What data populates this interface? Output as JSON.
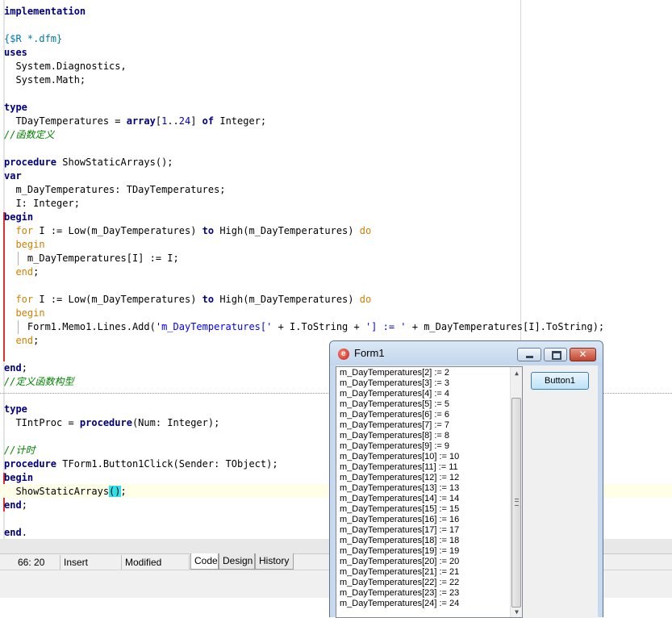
{
  "editor": {
    "lines": [
      {
        "tokens": [
          [
            "kw",
            "implementation"
          ]
        ]
      },
      {
        "tokens": []
      },
      {
        "tokens": [
          [
            "dir",
            "{$R *.dfm}"
          ]
        ]
      },
      {
        "tokens": [
          [
            "kw",
            "uses"
          ]
        ]
      },
      {
        "tokens": [
          [
            "p",
            "  System.Diagnostics,"
          ]
        ]
      },
      {
        "tokens": [
          [
            "p",
            "  System.Math;"
          ]
        ]
      },
      {
        "tokens": []
      },
      {
        "tokens": [
          [
            "kw",
            "type"
          ]
        ]
      },
      {
        "tokens": [
          [
            "p",
            "  TDayTemperatures = "
          ],
          [
            "kw",
            "array"
          ],
          [
            "p",
            "["
          ],
          [
            "num",
            "1"
          ],
          [
            "p",
            ".."
          ],
          [
            "num",
            "24"
          ],
          [
            "p",
            "] "
          ],
          [
            "kw",
            "of"
          ],
          [
            "p",
            " Integer;"
          ]
        ]
      },
      {
        "tokens": [
          [
            "cmt",
            "//函数定义"
          ]
        ]
      },
      {
        "tokens": []
      },
      {
        "tokens": [
          [
            "kw",
            "procedure"
          ],
          [
            "p",
            " ShowStaticArrays();"
          ]
        ]
      },
      {
        "tokens": [
          [
            "kw",
            "var"
          ]
        ]
      },
      {
        "tokens": [
          [
            "p",
            "  m_DayTemperatures: TDayTemperatures;"
          ]
        ]
      },
      {
        "tokens": [
          [
            "p",
            "  I: Integer;"
          ]
        ]
      },
      {
        "tokens": [
          [
            "kw",
            "begin"
          ]
        ]
      },
      {
        "tokens": [
          [
            "p",
            "  "
          ],
          [
            "kw2",
            "for"
          ],
          [
            "p",
            " I := Low(m_DayTemperatures) "
          ],
          [
            "kw",
            "to"
          ],
          [
            "p",
            " High(m_DayTemperatures) "
          ],
          [
            "kw2",
            "do"
          ]
        ]
      },
      {
        "tokens": [
          [
            "p",
            "  "
          ],
          [
            "kw2",
            "begin"
          ]
        ]
      },
      {
        "tokens": [
          [
            "p",
            "    m_DayTemperatures[I] := I;"
          ]
        ]
      },
      {
        "tokens": [
          [
            "p",
            "  "
          ],
          [
            "kw2",
            "end"
          ],
          [
            "p",
            ";"
          ]
        ]
      },
      {
        "tokens": []
      },
      {
        "tokens": [
          [
            "p",
            "  "
          ],
          [
            "kw2",
            "for"
          ],
          [
            "p",
            " I := Low(m_DayTemperatures) "
          ],
          [
            "kw",
            "to"
          ],
          [
            "p",
            " High(m_DayTemperatures) "
          ],
          [
            "kw2",
            "do"
          ]
        ]
      },
      {
        "tokens": [
          [
            "p",
            "  "
          ],
          [
            "kw2",
            "begin"
          ]
        ]
      },
      {
        "tokens": [
          [
            "p",
            "    Form1.Memo1.Lines.Add("
          ],
          [
            "str",
            "'m_DayTemperatures['"
          ],
          [
            "p",
            " + I.ToString + "
          ],
          [
            "str",
            "'] := '"
          ],
          [
            "p",
            " + m_DayTemperatures[I].ToString);"
          ]
        ]
      },
      {
        "tokens": [
          [
            "p",
            "  "
          ],
          [
            "kw2",
            "end"
          ],
          [
            "p",
            ";"
          ]
        ]
      },
      {
        "tokens": []
      },
      {
        "tokens": [
          [
            "kw",
            "end"
          ],
          [
            "p",
            ";"
          ]
        ]
      },
      {
        "tokens": [
          [
            "cmt",
            "//定义函数构型"
          ]
        ]
      },
      {
        "tokens": []
      },
      {
        "tokens": [
          [
            "kw",
            "type"
          ]
        ]
      },
      {
        "tokens": [
          [
            "p",
            "  TIntProc = "
          ],
          [
            "kw",
            "procedure"
          ],
          [
            "p",
            "(Num: Integer);"
          ]
        ]
      },
      {
        "tokens": []
      },
      {
        "tokens": [
          [
            "cmt",
            "//计时"
          ]
        ]
      },
      {
        "tokens": [
          [
            "kw",
            "procedure"
          ],
          [
            "p",
            " TForm1.Button1Click(Sender: TObject);"
          ]
        ]
      },
      {
        "tokens": [
          [
            "kw",
            "begin"
          ]
        ]
      },
      {
        "tokens": [
          [
            "p",
            "  ShowStaticArrays"
          ],
          [
            "hl",
            "()"
          ],
          [
            "p",
            ";"
          ]
        ]
      },
      {
        "tokens": [
          [
            "kw",
            "end"
          ],
          [
            "p",
            ";"
          ]
        ]
      },
      {
        "tokens": []
      },
      {
        "tokens": [
          [
            "kw",
            "end"
          ],
          [
            "p",
            "."
          ]
        ]
      }
    ]
  },
  "status": {
    "position": "66: 20",
    "mode": "Insert",
    "state": "Modified"
  },
  "tabs": {
    "code": "Code",
    "design": "Design",
    "history": "History"
  },
  "form": {
    "title": "Form1",
    "button1_label": "Button1",
    "memo_lines": [
      "m_DayTemperatures[2] := 2",
      "m_DayTemperatures[3] := 3",
      "m_DayTemperatures[4] := 4",
      "m_DayTemperatures[5] := 5",
      "m_DayTemperatures[6] := 6",
      "m_DayTemperatures[7] := 7",
      "m_DayTemperatures[8] := 8",
      "m_DayTemperatures[9] := 9",
      "m_DayTemperatures[10] := 10",
      "m_DayTemperatures[11] := 11",
      "m_DayTemperatures[12] := 12",
      "m_DayTemperatures[13] := 13",
      "m_DayTemperatures[14] := 14",
      "m_DayTemperatures[15] := 15",
      "m_DayTemperatures[16] := 16",
      "m_DayTemperatures[17] := 17",
      "m_DayTemperatures[18] := 18",
      "m_DayTemperatures[19] := 19",
      "m_DayTemperatures[20] := 20",
      "m_DayTemperatures[21] := 21",
      "m_DayTemperatures[22] := 22",
      "m_DayTemperatures[23] := 23",
      "m_DayTemperatures[24] := 24"
    ]
  },
  "colors": {
    "keyword": "#00007f",
    "keyword_alt": "#d08000",
    "comment": "#008000",
    "string": "#0000ff",
    "number": "#0000c0",
    "directive": "#0078a8",
    "bracket_highlight": "#30e0e8",
    "change_marker": "#e03030"
  }
}
